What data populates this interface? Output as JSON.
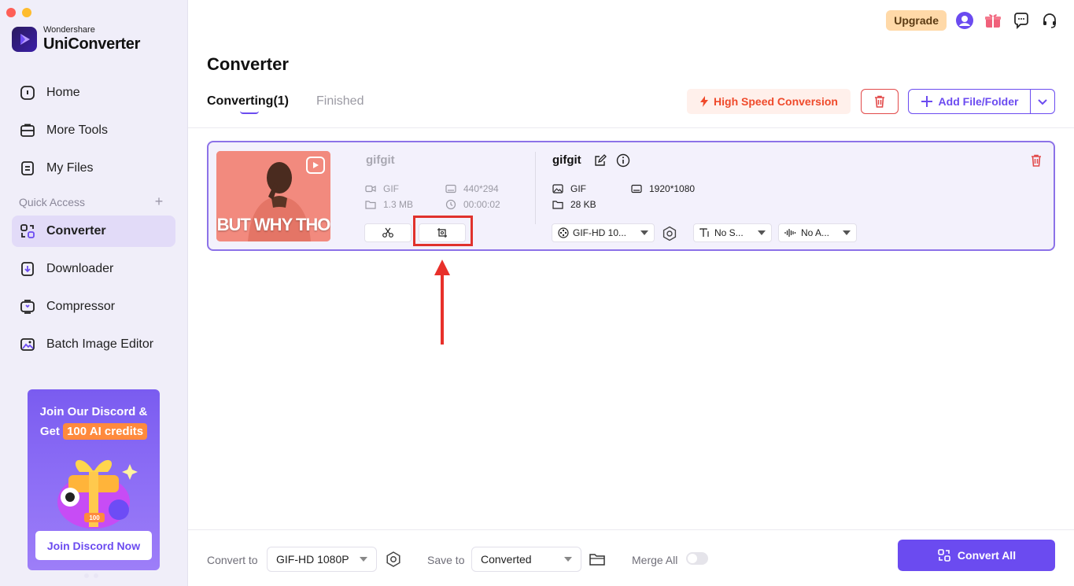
{
  "app": {
    "brand_small": "Wondershare",
    "brand_big": "UniConverter"
  },
  "sidebar": {
    "items": [
      {
        "label": "Home"
      },
      {
        "label": "More Tools"
      },
      {
        "label": "My Files"
      }
    ],
    "quick_access_label": "Quick Access",
    "quick_items": [
      {
        "label": "Converter"
      },
      {
        "label": "Downloader"
      },
      {
        "label": "Compressor"
      },
      {
        "label": "Batch Image Editor"
      }
    ]
  },
  "promo": {
    "line1": "Join Our Discord &",
    "line2_prefix": "Get",
    "badge": "100 AI credits",
    "art_text": "100",
    "button": "Join Discord Now"
  },
  "topbar": {
    "upgrade": "Upgrade"
  },
  "main": {
    "title": "Converter",
    "tabs": [
      {
        "label": "Converting(1)"
      },
      {
        "label": "Finished"
      }
    ],
    "high_speed": "High Speed Conversion",
    "add_file": "Add File/Folder"
  },
  "file": {
    "thumb_text": "BUT WHY THO",
    "source": {
      "name": "gifgit",
      "format": "GIF",
      "size": "1.3 MB",
      "resolution": "440*294",
      "duration": "00:00:02"
    },
    "output": {
      "name": "gifgit",
      "format": "GIF",
      "size": "28 KB",
      "resolution": "1920*1080",
      "preset": "GIF-HD 10...",
      "subtitle": "No S...",
      "audio": "No A..."
    }
  },
  "bottom": {
    "convert_to_label": "Convert to",
    "convert_to_value": "GIF-HD 1080P",
    "save_to_label": "Save to",
    "save_to_value": "Converted",
    "merge_label": "Merge All",
    "convert_all": "Convert All"
  },
  "colors": {
    "accent": "#6b4bf0",
    "danger": "#e0322c",
    "upgrade_bg": "#ffd9a8"
  }
}
